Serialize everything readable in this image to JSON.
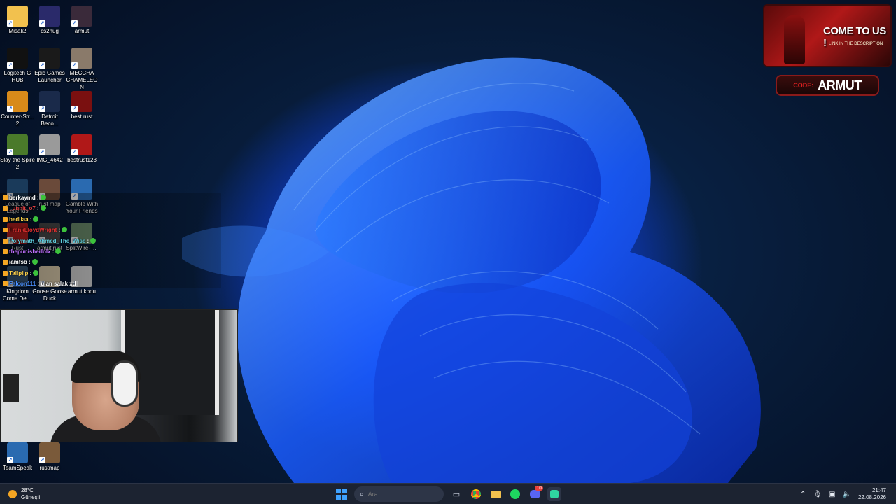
{
  "desktop": {
    "icons": [
      {
        "label": "Misali2",
        "icon": "folder-icon",
        "color": "#f2c14e"
      },
      {
        "label": "cs2hug",
        "icon": "image-icon",
        "color": "#2a2a6a"
      },
      {
        "label": "armut",
        "icon": "image-icon",
        "color": "#3a2a3a"
      },
      {
        "label": "Logitech G HUB",
        "icon": "logitech-icon",
        "color": "#111111"
      },
      {
        "label": "Epic Games Launcher",
        "icon": "epic-icon",
        "color": "#1a1a1a"
      },
      {
        "label": "MECCHA CHAMELEON",
        "icon": "image-icon",
        "color": "#8a7a6a"
      },
      {
        "label": "Counter-Str... 2",
        "icon": "cs2-icon",
        "color": "#d88a1a"
      },
      {
        "label": "Detroit Beco...",
        "icon": "detroit-icon",
        "color": "#1a2a4a"
      },
      {
        "label": "best rust",
        "icon": "image-icon",
        "color": "#7a1010"
      },
      {
        "label": "Slay the Spire 2",
        "icon": "sts-icon",
        "color": "#4a7a2a"
      },
      {
        "label": "IMG_4642",
        "icon": "image-icon",
        "color": "#9a9a9a"
      },
      {
        "label": "bestrust123",
        "icon": "rust-icon",
        "color": "#b01818"
      },
      {
        "label": "League of Legends",
        "icon": "lol-icon",
        "color": "#1a3a5a"
      },
      {
        "label": "rust map",
        "icon": "image-icon",
        "color": "#6a4a3a"
      },
      {
        "label": "Gamble With Your Friends",
        "icon": "gamble-icon",
        "color": "#2a6ab0"
      },
      {
        "label": "Rust",
        "icon": "rust-icon",
        "color": "#c02020"
      },
      {
        "label": "armut rust",
        "icon": "image-icon",
        "color": "#4a4a4a"
      },
      {
        "label": "SplitWire-T...",
        "icon": "splitwire-icon",
        "color": "#6a8a6a"
      },
      {
        "label": "Kingdom Come Del...",
        "icon": "kingdom-icon",
        "color": "#3a5a7a"
      },
      {
        "label": "Goose Goose Duck",
        "icon": "goose-icon",
        "color": "#e0d0b0"
      },
      {
        "label": "armut kodu",
        "icon": "text-file-icon",
        "color": "#d0d0d0"
      },
      {
        "label": "TeamSpeak",
        "icon": "teamspeak-icon",
        "color": "#2a6ab0"
      },
      {
        "label": "rustmap",
        "icon": "image-icon",
        "color": "#7a5a3a"
      }
    ]
  },
  "chat": {
    "messages": [
      {
        "user": "berkaymd",
        "text": ":",
        "color": "#ffffff"
      },
      {
        "user": "_unnit_o7",
        "text": ":",
        "color": "#e04040"
      },
      {
        "user": "bedilaa",
        "text": ":",
        "color": "#ffd24a"
      },
      {
        "user": "FrankLloydWright",
        "text": ":",
        "color": "#e03030"
      },
      {
        "user": "Polymath_Ahmed_The_Wise",
        "text": ":",
        "color": "#5fd0e0"
      },
      {
        "user": "thepunisherlolx",
        "text": ":",
        "color": "#c070ff"
      },
      {
        "user": "iamfsb",
        "text": ":",
        "color": "#ffffff"
      },
      {
        "user": "Tallplip",
        "text": ":",
        "color": "#ffd24a"
      },
      {
        "user": "Falcon111",
        "text": ": ulan salak xd",
        "color": "#4a90ff"
      }
    ]
  },
  "ad": {
    "headline": "COME TO US !",
    "subline": "LINK IN THE DESCRIPTION",
    "code_label": "CODE:",
    "code_value": "ARMUT"
  },
  "taskbar": {
    "weather": {
      "temp": "28°C",
      "condition": "Güneşli"
    },
    "search_placeholder": "Ara",
    "apps": [
      {
        "name": "task-view",
        "icon": "task-view-icon"
      },
      {
        "name": "chrome",
        "icon": "chrome-icon"
      },
      {
        "name": "file-explorer",
        "icon": "folder-icon"
      },
      {
        "name": "spotify",
        "icon": "spotify-icon"
      },
      {
        "name": "discord",
        "icon": "discord-icon",
        "badge": "10"
      },
      {
        "name": "app-active",
        "icon": "app-icon"
      }
    ],
    "clock": {
      "time": "21:47",
      "date": "22.08.2026"
    }
  },
  "colors": {
    "taskbar_bg": "#1c2331",
    "accent": "#3fa2ff",
    "ad_red": "#b01818"
  }
}
